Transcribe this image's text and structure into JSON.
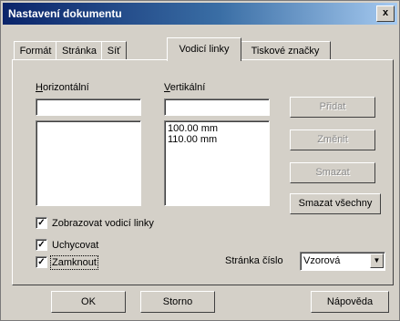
{
  "window": {
    "title": "Nastavení dokumentu",
    "close_symbol": "x"
  },
  "tabs": [
    {
      "label": "Formát"
    },
    {
      "label": "Stránka"
    },
    {
      "label": "Síť"
    },
    {
      "label": "Vodicí linky",
      "active": true
    },
    {
      "label": "Tiskové značky"
    }
  ],
  "horizontal": {
    "label": "Horizontální",
    "value": "",
    "items": []
  },
  "vertical": {
    "label": "Vertikální",
    "value": "",
    "items": [
      "100.00 mm",
      "110.00 mm"
    ]
  },
  "side_buttons": {
    "add": "Přidat",
    "change": "Změnit",
    "delete": "Smazat",
    "delete_all": "Smazat všechny"
  },
  "options": {
    "show_guides": {
      "label": "Zobrazovat vodicí linky",
      "checked": true
    },
    "snap": {
      "label": "Uchycovat",
      "checked": true
    },
    "lock": {
      "label": "Zamknout",
      "checked": true
    }
  },
  "page_number": {
    "label": "Stránka číslo",
    "value": "Vzorová"
  },
  "footer": {
    "ok": "OK",
    "cancel": "Storno",
    "help": "Nápověda"
  },
  "check_mark": "✓",
  "dropdown_arrow": "▼",
  "colors": {
    "title_start": "#0a246a",
    "title_end": "#a6caf0",
    "face": "#d4d0c8"
  }
}
